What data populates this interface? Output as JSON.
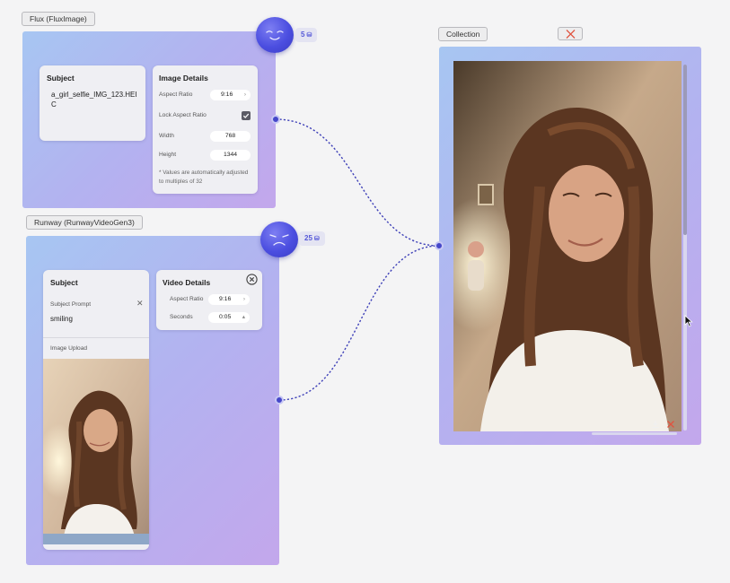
{
  "flux_node": {
    "title": "Flux (FluxImage)",
    "credits": "5",
    "subject_card": {
      "title": "Subject",
      "filename": "a_girl_selfie_IMG_123.HEIC"
    },
    "image_details": {
      "title": "Image Details",
      "aspect_ratio_label": "Aspect Ratio",
      "aspect_ratio_value": "9:16",
      "lock_label": "Lock Aspect Ratio",
      "lock_checked": true,
      "width_label": "Width",
      "width_value": "768",
      "height_label": "Height",
      "height_value": "1344",
      "note": "* Values are automatically adjusted to multiples of 32"
    }
  },
  "runway_node": {
    "title": "Runway (RunwayVideoGen3)",
    "credits": "25",
    "subject_card": {
      "title": "Subject",
      "prompt_label": "Subject Prompt",
      "prompt_value": "smiling",
      "upload_label": "Image Upload"
    },
    "video_details": {
      "title": "Video Details",
      "aspect_ratio_label": "Aspect Ratio",
      "aspect_ratio_value": "9:16",
      "seconds_label": "Seconds",
      "seconds_value": "0:05"
    }
  },
  "collection_node": {
    "title": "Collection"
  },
  "icons": {
    "close": "close-x-icon",
    "coin": "coin-stack-icon",
    "check": "checkmark-icon",
    "download": "download-icon",
    "chevron": "chevron-right-icon",
    "clear": "clear-x-icon"
  },
  "colors": {
    "accent": "#4b4ee0",
    "connector": "#3f41b8",
    "delete_red": "#e0533f",
    "panel_from": "#a7c6f2",
    "panel_to": "#c3a7ec"
  }
}
